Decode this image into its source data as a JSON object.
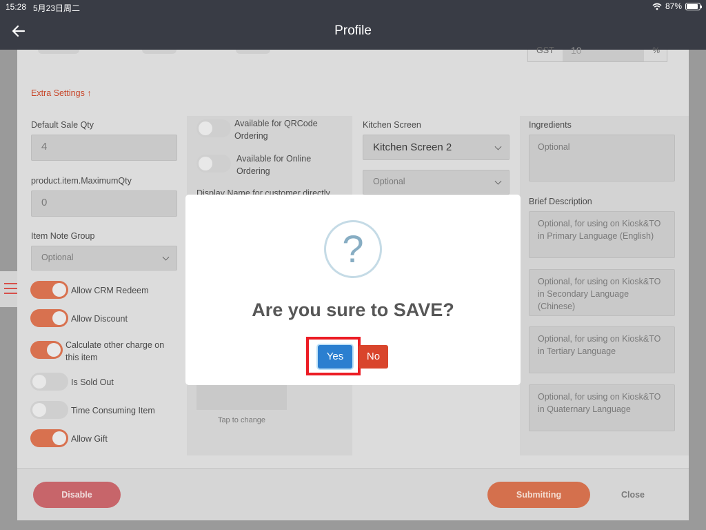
{
  "status_bar": {
    "time": "15:28",
    "date": "5月23日周二",
    "battery": "87%"
  },
  "header": {
    "title": "Profile"
  },
  "top_partial": {
    "gst_label": "GST",
    "gst_value": "10",
    "percent": "%"
  },
  "extra_settings": {
    "label": "Extra Settings ↑"
  },
  "left_col": {
    "default_sale_qty_label": "Default Sale Qty",
    "default_sale_qty_value": "4",
    "max_qty_label": "product.item.MaximumQty",
    "max_qty_value": "0",
    "item_note_group_label": "Item Note Group",
    "item_note_group_value": "Optional",
    "toggles": [
      {
        "label": "Allow CRM Redeem",
        "on": true
      },
      {
        "label": "Allow Discount",
        "on": true
      },
      {
        "label": "Calculate other charge on this item",
        "on": true
      },
      {
        "label": "Is Sold Out",
        "on": false
      },
      {
        "label": "Time Consuming Item",
        "on": false
      },
      {
        "label": "Allow Gift",
        "on": true
      }
    ]
  },
  "mid_col": {
    "qrcode_label": "Available for QRCode Ordering",
    "online_label": "Available for Online Ordering",
    "display_name_label": "Display Name for customer directly",
    "tap_to_change": "Tap to change"
  },
  "kitchen_col": {
    "kitchen_screen_label": "Kitchen Screen",
    "kitchen_screen_value": "Kitchen Screen 2",
    "second_select_value": "Optional"
  },
  "right_col": {
    "ingredients_label": "Ingredients",
    "ingredients_placeholder": "Optional",
    "brief_description_label": "Brief Description",
    "descriptions": [
      "Optional, for using on Kiosk&TO in Primary Language (English)",
      "Optional, for using on Kiosk&TO in Secondary Language (Chinese)",
      "Optional, for using on Kiosk&TO in Tertiary Language",
      "Optional, for using on Kiosk&TO in Quaternary Language"
    ]
  },
  "footer": {
    "disable": "Disable",
    "submitting": "Submitting",
    "close": "Close"
  },
  "modal": {
    "icon_char": "?",
    "title": "Are you sure to SAVE?",
    "yes": "Yes",
    "no": "No"
  }
}
